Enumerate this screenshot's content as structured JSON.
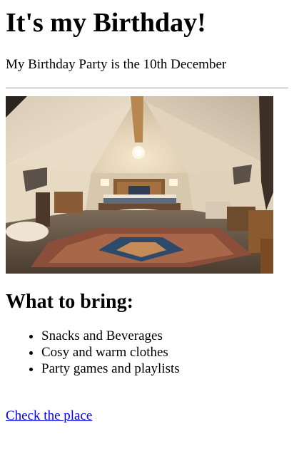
{
  "page": {
    "title": "It's my Birthday!",
    "intro": "My Birthday Party is the 10th December"
  },
  "photo": {
    "description_icon": "glamping-tent-photo"
  },
  "bring": {
    "heading": "What to bring:",
    "items": [
      "Snacks and Beverages",
      "Cosy and warm clothes",
      "Party games and playlists"
    ]
  },
  "link": {
    "label": "Check the place"
  },
  "colors": {
    "link": "#0000ee",
    "divider": "#9a9a9a",
    "text": "#000000",
    "background": "#ffffff"
  }
}
